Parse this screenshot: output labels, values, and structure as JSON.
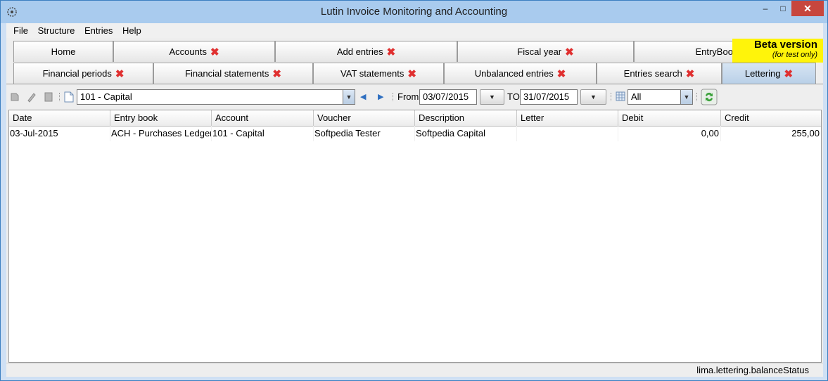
{
  "window": {
    "title": "Lutin Invoice Monitoring and Accounting",
    "minimize": "–",
    "maximize": "□",
    "close": "✕"
  },
  "menu": [
    "File",
    "Structure",
    "Entries",
    "Help"
  ],
  "beta": {
    "title": "Beta version",
    "subtitle": "(for test only)"
  },
  "tabs_row1": [
    {
      "label": "Home",
      "closable": false
    },
    {
      "label": "Accounts",
      "closable": true
    },
    {
      "label": "Add entries",
      "closable": true
    },
    {
      "label": "Fiscal year",
      "closable": true
    },
    {
      "label": "EntryBooks",
      "closable": true
    }
  ],
  "tabs_row2": [
    {
      "label": "Financial periods",
      "closable": true
    },
    {
      "label": "Financial statements",
      "closable": true
    },
    {
      "label": "VAT statements",
      "closable": true
    },
    {
      "label": "Unbalanced entries",
      "closable": true
    },
    {
      "label": "Entries search",
      "closable": true
    },
    {
      "label": "Lettering",
      "closable": true,
      "active": true
    }
  ],
  "close_glyph": "✖",
  "toolbar": {
    "account": "101 - Capital",
    "from_label": "From",
    "from_date": "03/07/2015",
    "to_label": "TO",
    "to_date": "31/07/2015",
    "filter": "All",
    "dropdown_glyph": "▼",
    "prev_glyph": "◀",
    "next_glyph": "▶"
  },
  "table": {
    "columns": [
      "Date",
      "Entry book",
      "Account",
      "Voucher",
      "Description",
      "Letter",
      "Debit",
      "Credit"
    ],
    "rows": [
      [
        "03-Jul-2015",
        "ACH - Purchases Ledger",
        "101 - Capital",
        "Softpedia Tester",
        "Softpedia Capital",
        "",
        "0,00",
        "255,00"
      ]
    ]
  },
  "status": "lima.lettering.balanceStatus",
  "colors": {
    "accent": "#a9cbee",
    "beta": "#fff40a",
    "close_x": "#e03030"
  }
}
